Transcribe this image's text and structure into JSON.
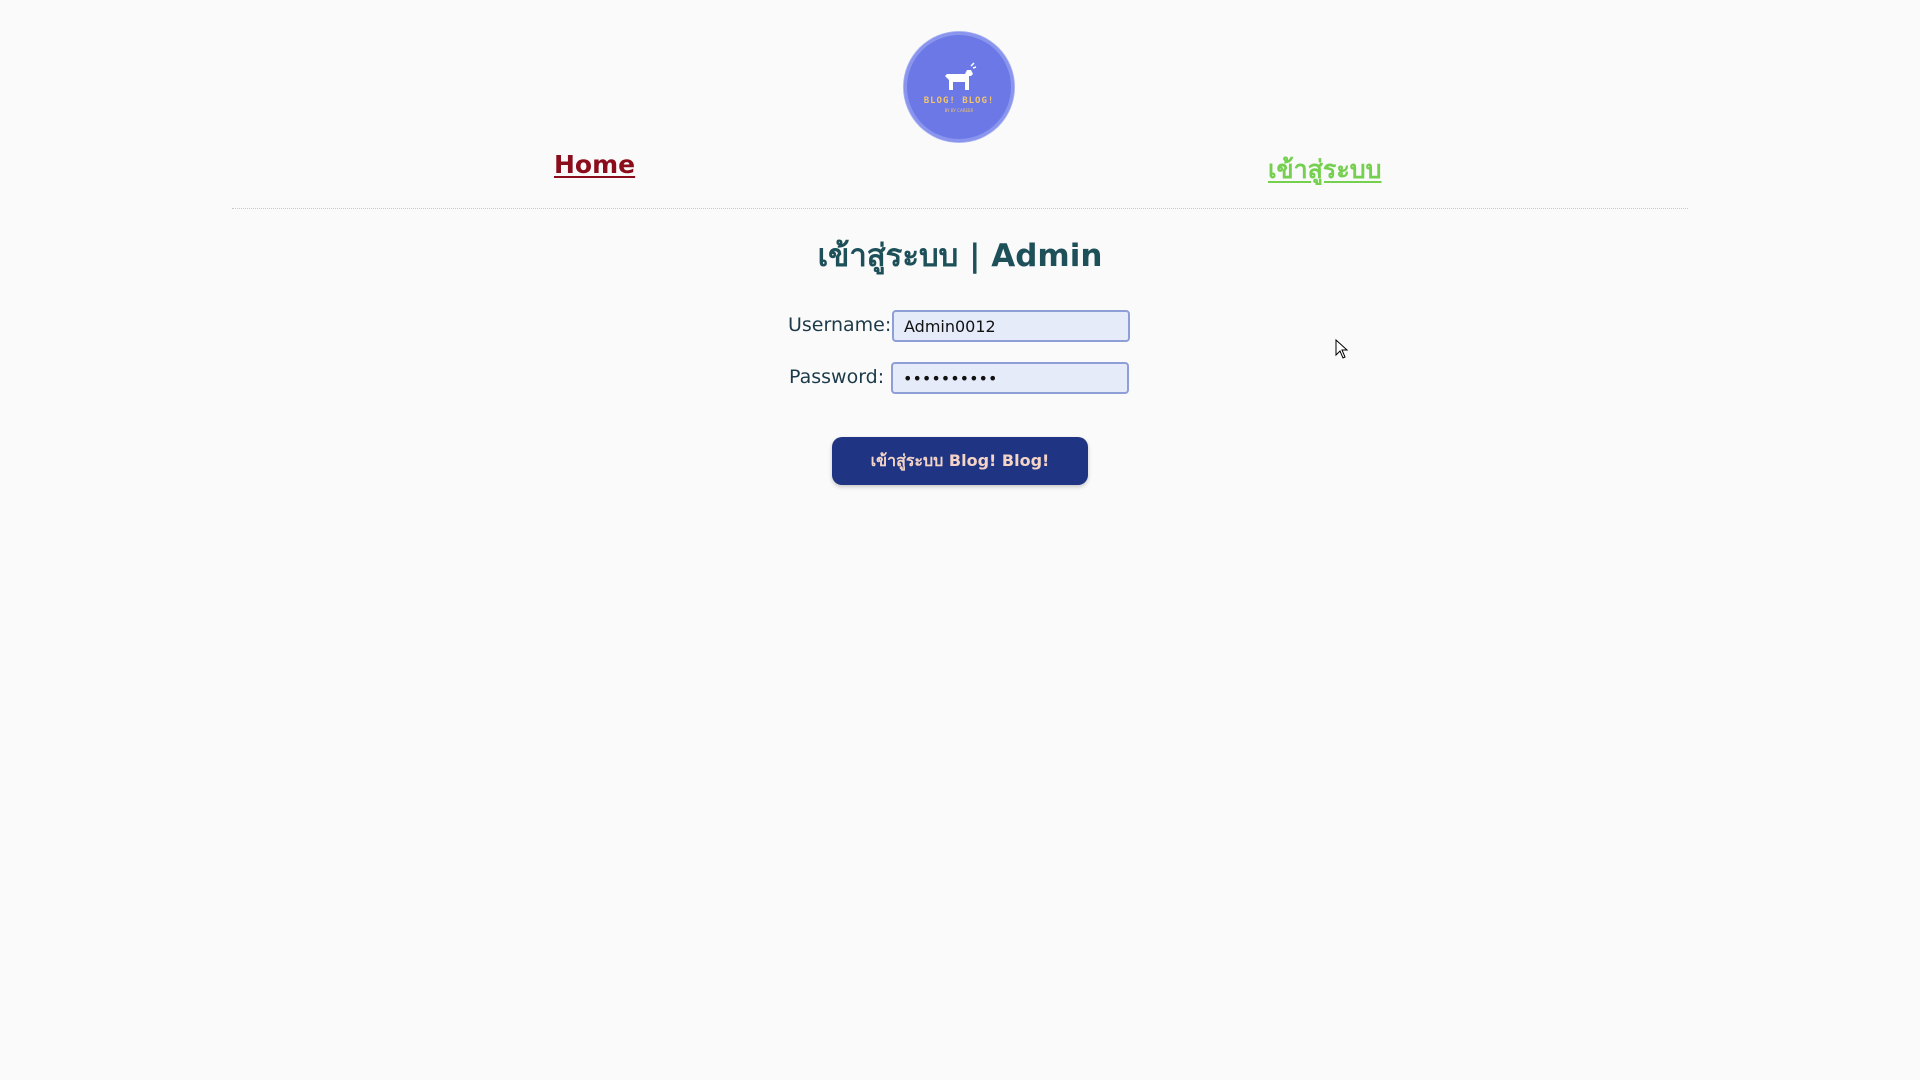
{
  "logo": {
    "icon": "dog-icon",
    "text": "BLOG! BLOG!",
    "subtext": "BY BY CAREER",
    "color": "#6b78e6"
  },
  "nav": {
    "home_label": "Home",
    "login_label": "เข้าสู่ระบบ",
    "home_color": "#8b0d1c",
    "login_color": "#74d04e"
  },
  "form": {
    "title": "เข้าสู่ระบบ | Admin",
    "username_label": "Username:",
    "username_value": "Admin0012",
    "password_label": "Password:",
    "password_value": "••••••••••",
    "submit_label": "เข้าสู่ระบบ Blog! Blog!",
    "submit_color": "#1f3583"
  }
}
